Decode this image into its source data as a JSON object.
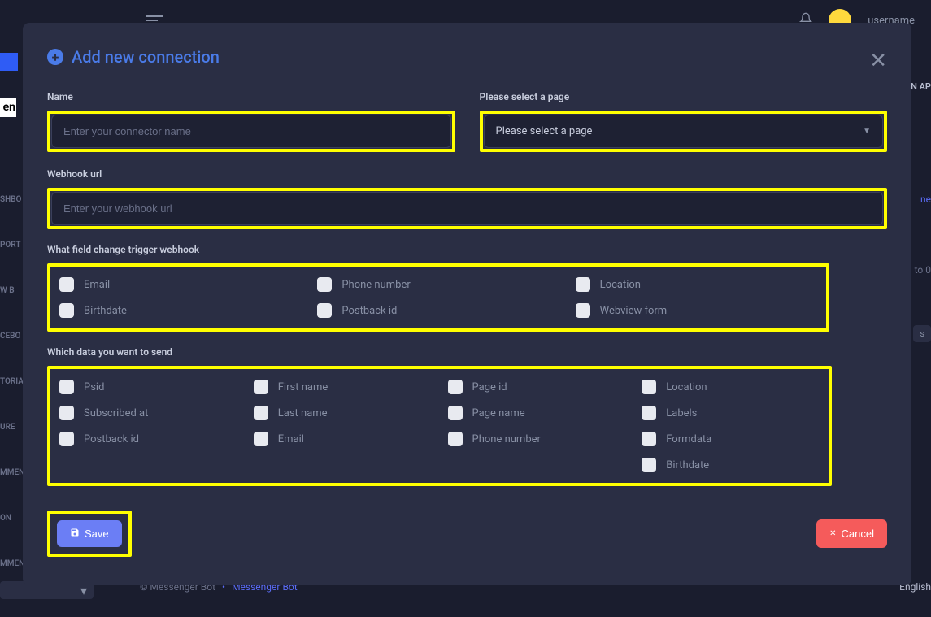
{
  "bg": {
    "username": "username",
    "sidebar": [
      "SHBO",
      "PORT",
      "W B",
      "CEBO",
      "TORIA",
      "URE",
      "MMEN",
      "ON",
      "MMENT"
    ],
    "rightTop": "N AP",
    "rightLink": "ne",
    "rightDim": "to 0",
    "rightBadge": "s",
    "footerLeft": "© Messenger Bot",
    "footerBullet": "•",
    "footerLink": "Messenger Bot",
    "footerLang": "English",
    "logoText": "en"
  },
  "modal": {
    "title": "Add new connection",
    "labels": {
      "name": "Name",
      "page": "Please select a page",
      "webhook": "Webhook url",
      "triggers": "What field change trigger webhook",
      "senddata": "Which data you want to send"
    },
    "placeholders": {
      "name": "Enter your connector name",
      "webhook": "Enter your webhook url"
    },
    "select": {
      "placeholder": "Please select a page"
    },
    "triggers": [
      {
        "key": "email",
        "label": "Email"
      },
      {
        "key": "phone",
        "label": "Phone number"
      },
      {
        "key": "location",
        "label": "Location"
      },
      {
        "key": "birthdate",
        "label": "Birthdate"
      },
      {
        "key": "postback",
        "label": "Postback id"
      },
      {
        "key": "webview",
        "label": "Webview form"
      }
    ],
    "send": [
      {
        "key": "psid",
        "label": "Psid"
      },
      {
        "key": "firstname",
        "label": "First name"
      },
      {
        "key": "pageid",
        "label": "Page id"
      },
      {
        "key": "location2",
        "label": "Location"
      },
      {
        "key": "subscribed",
        "label": "Subscribed at"
      },
      {
        "key": "lastname",
        "label": "Last name"
      },
      {
        "key": "pagename",
        "label": "Page name"
      },
      {
        "key": "labels",
        "label": "Labels"
      },
      {
        "key": "postback2",
        "label": "Postback id"
      },
      {
        "key": "email2",
        "label": "Email"
      },
      {
        "key": "phone2",
        "label": "Phone number"
      },
      {
        "key": "formdata",
        "label": "Formdata"
      },
      {
        "key": "",
        "label": ""
      },
      {
        "key": "",
        "label": ""
      },
      {
        "key": "",
        "label": ""
      },
      {
        "key": "birthdate2",
        "label": "Birthdate"
      }
    ],
    "buttons": {
      "save": "Save",
      "cancel": "Cancel"
    }
  }
}
